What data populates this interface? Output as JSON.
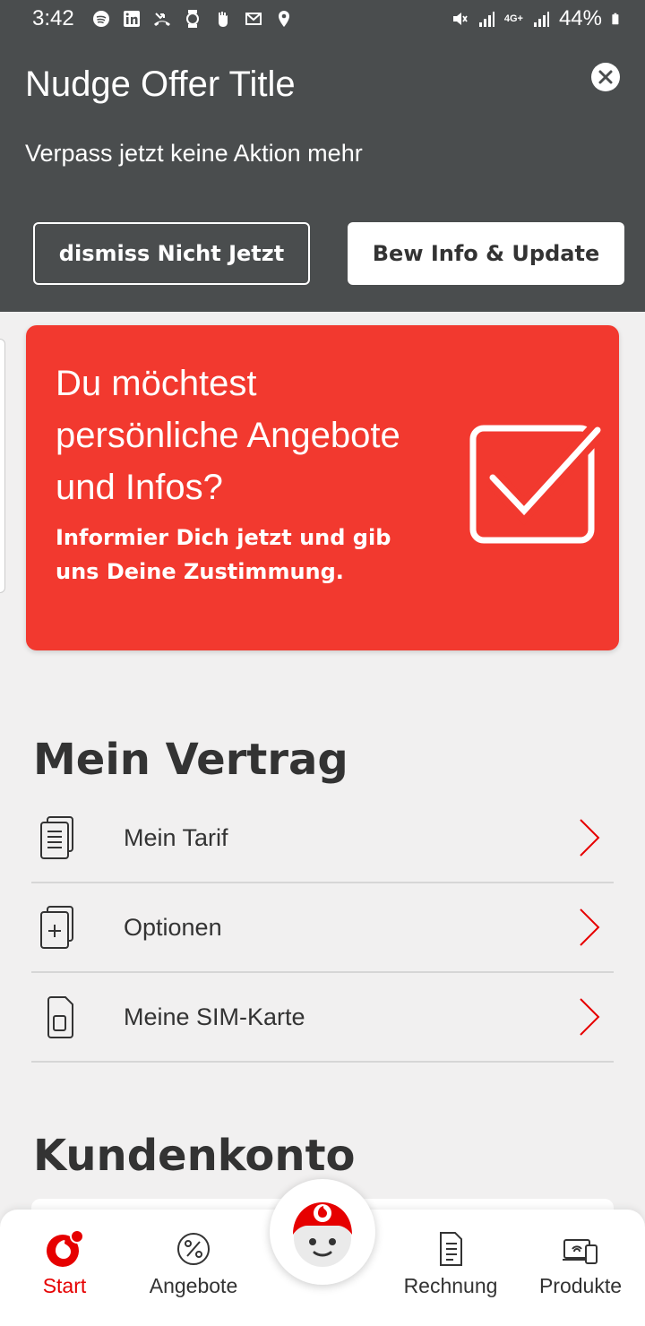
{
  "status_bar": {
    "time": "3:42",
    "battery": "44%",
    "network": "4G+"
  },
  "nudge": {
    "title": "Nudge Offer Title",
    "text": "Verpass jetzt keine Aktion mehr",
    "dismiss_label": "dismiss Nicht Jetzt",
    "action_label": "Bew Info & Update",
    "close_icon": "close-icon"
  },
  "promo": {
    "heading": "Du möchtest persönliche Angebote und Infos?",
    "subtext": "Informier Dich jetzt und gib uns Deine Zustimmung.",
    "icon": "checkbox-checked-icon",
    "color": "#f2392f"
  },
  "contract": {
    "title": "Mein Vertrag",
    "items": [
      {
        "label": "Mein Tarif",
        "icon": "document-icon"
      },
      {
        "label": "Optionen",
        "icon": "add-document-icon"
      },
      {
        "label": "Meine SIM-Karte",
        "icon": "sim-card-icon"
      }
    ]
  },
  "account": {
    "title": "Kundenkonto"
  },
  "nav": {
    "items": [
      {
        "label": "Start",
        "icon": "vodafone-logo-icon",
        "active": true
      },
      {
        "label": "Angebote",
        "icon": "percent-icon",
        "active": false
      },
      {
        "label": "Rechnung",
        "icon": "invoice-icon",
        "active": false
      },
      {
        "label": "Produkte",
        "icon": "devices-icon",
        "active": false
      }
    ],
    "center": "tobi-chatbot-icon"
  },
  "colors": {
    "accent": "#e60000",
    "header_bg": "#4a4d4e",
    "page_bg": "#f1f0f0"
  }
}
